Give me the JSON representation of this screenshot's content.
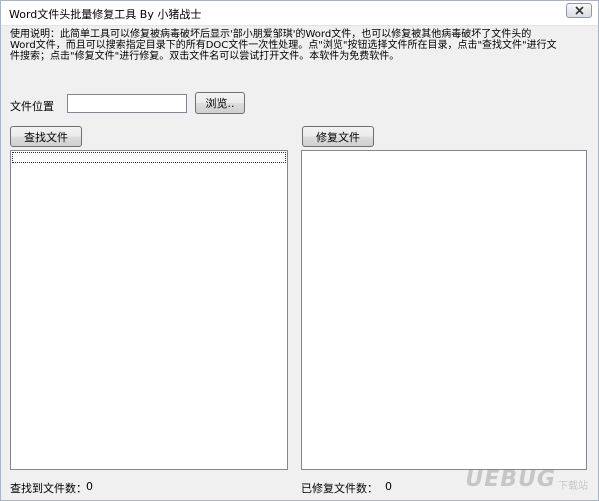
{
  "window": {
    "title": "Word文件头批量修复工具  By 小猪战士",
    "close_icon": "close-icon"
  },
  "description": {
    "lines": [
      "使用说明：此简单工具可以修复被病毒破坏后显示'部小朋爱邹琪'的Word文件，也可以修复被其他病毒破坏了文件头的",
      "Word文件，而且可以搜索指定目录下的所有DOC文件一次性处理。点\"浏览\"按钮选择文件所在目录，点击\"查找文件\"进行文",
      "件搜索；点击\"修复文件\"进行修复。双击文件名可以尝试打开文件。本软件为免费软件。"
    ]
  },
  "location": {
    "label": "文件位置",
    "value": "",
    "browse_label": "浏览.."
  },
  "left_panel": {
    "button_label": "查找文件",
    "items": [],
    "count_label": "查找到文件数：",
    "count_value": "0"
  },
  "right_panel": {
    "button_label": "修复文件",
    "items": [],
    "count_label": "已修复文件数：",
    "count_value": "0"
  },
  "watermark": {
    "text": "UEBUG",
    "sub": "下载站"
  }
}
